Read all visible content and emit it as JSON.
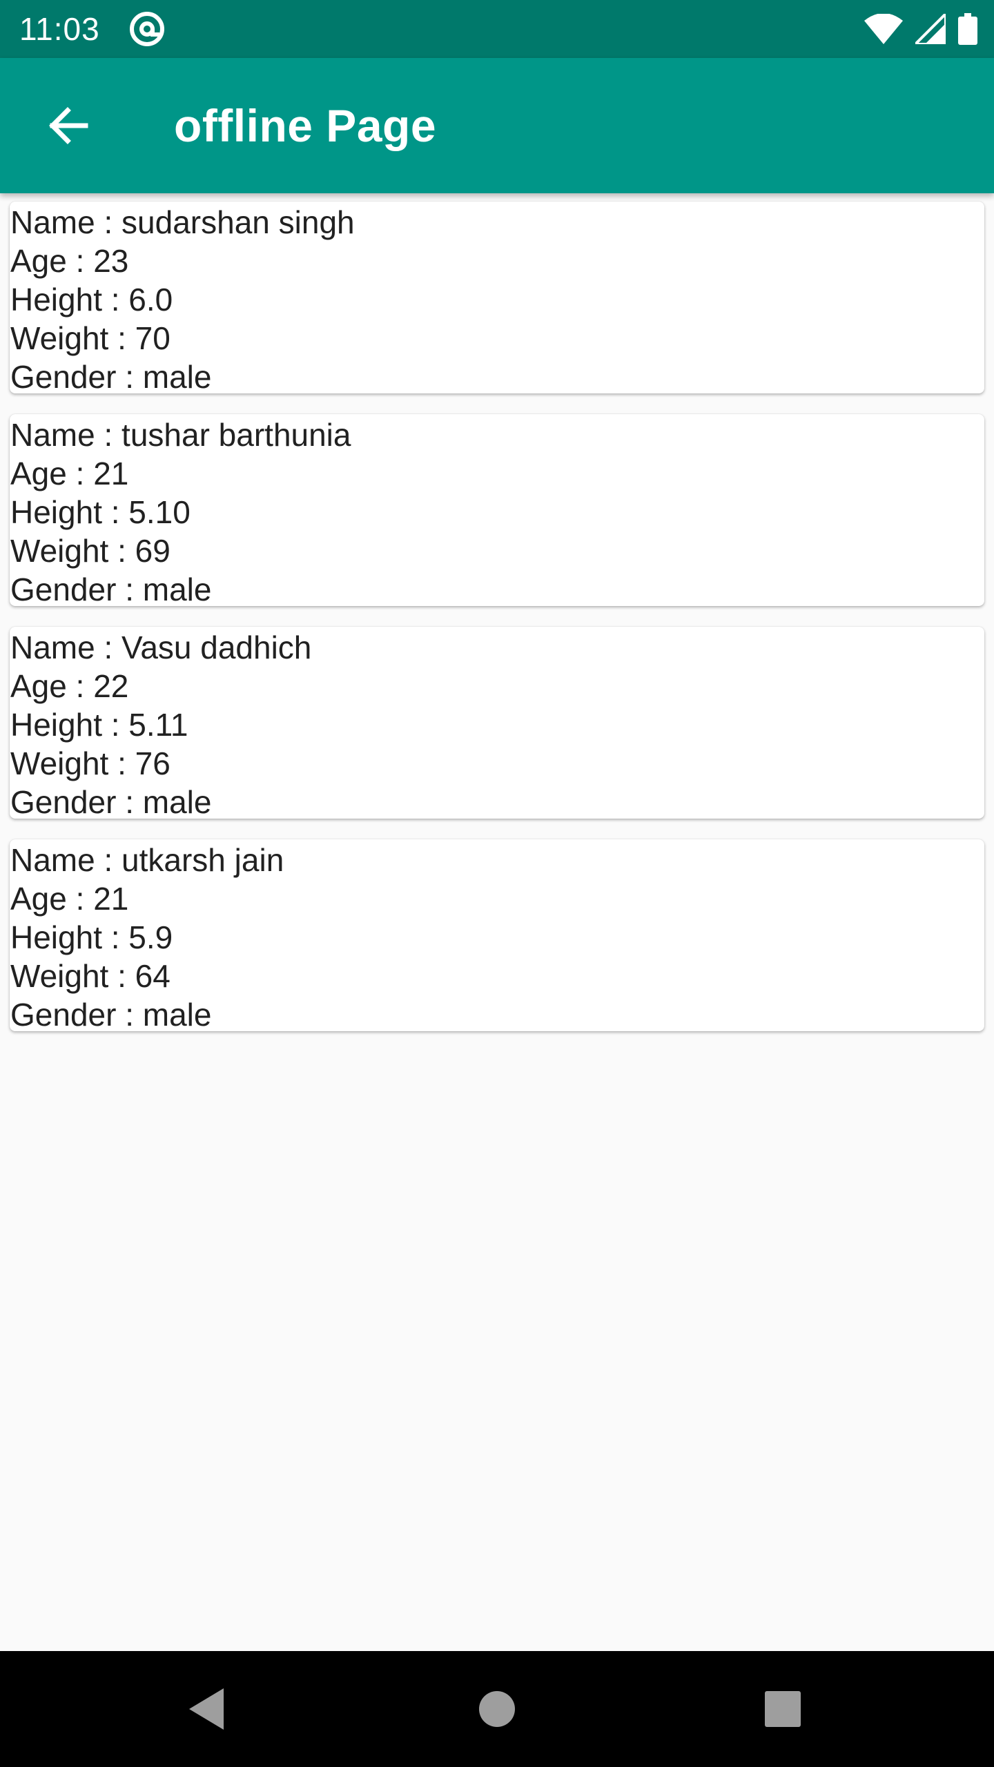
{
  "status_bar": {
    "time": "11:03",
    "icons": [
      "at-sign-icon",
      "wifi-icon",
      "cellular-signal-icon",
      "battery-icon"
    ]
  },
  "app_bar": {
    "title": "offline Page",
    "back_icon": "arrow-back-icon",
    "color": "#009688"
  },
  "people": [
    {
      "name": "Name : sudarshan singh",
      "age": "Age : 23",
      "height": "Height : 6.0",
      "weight": "Weight : 70",
      "gender": "Gender : male"
    },
    {
      "name": "Name : tushar barthunia",
      "age": "Age : 21",
      "height": "Height : 5.10",
      "weight": "Weight : 69",
      "gender": "Gender : male"
    },
    {
      "name": "Name : Vasu dadhich",
      "age": "Age : 22",
      "height": "Height : 5.11",
      "weight": "Weight : 76",
      "gender": "Gender : male"
    },
    {
      "name": "Name : utkarsh jain",
      "age": "Age : 21",
      "height": "Height : 5.9",
      "weight": "Weight : 64",
      "gender": "Gender : male"
    }
  ],
  "nav_bar": {
    "buttons": [
      "back-triangle-icon",
      "home-circle-icon",
      "recents-square-icon"
    ]
  }
}
